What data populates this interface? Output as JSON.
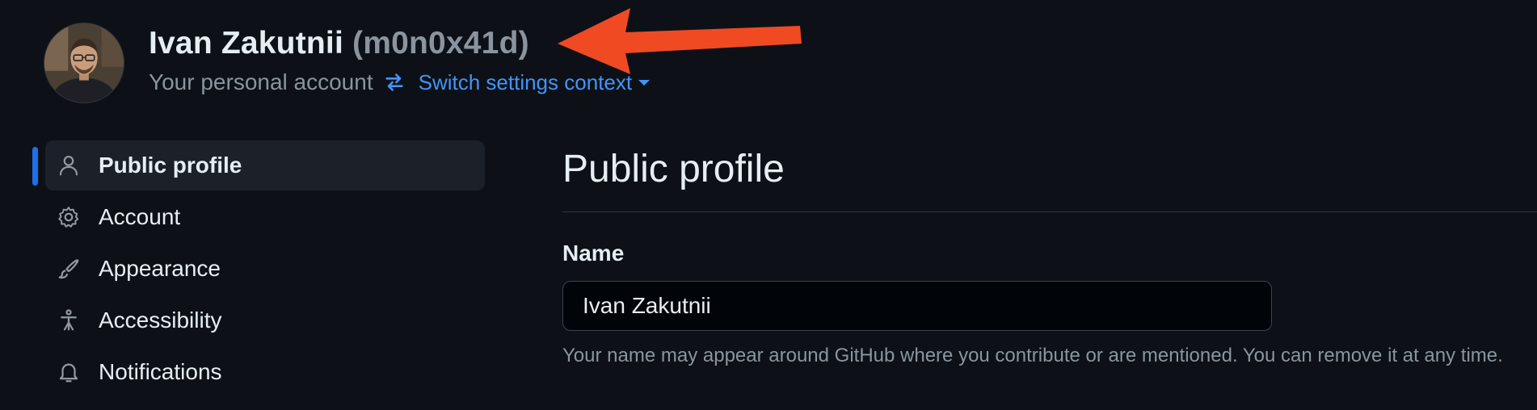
{
  "header": {
    "display_name": "Ivan Zakutnii",
    "login": "(m0n0x41d)",
    "account_type": "Your personal account",
    "switch_context_label": "Switch settings context"
  },
  "sidebar": {
    "items": [
      {
        "label": "Public profile",
        "icon": "person-icon",
        "active": true
      },
      {
        "label": "Account",
        "icon": "gear-icon",
        "active": false
      },
      {
        "label": "Appearance",
        "icon": "paintbrush-icon",
        "active": false
      },
      {
        "label": "Accessibility",
        "icon": "accessibility-icon",
        "active": false
      },
      {
        "label": "Notifications",
        "icon": "bell-icon",
        "active": false
      }
    ]
  },
  "main": {
    "title": "Public profile",
    "name_field": {
      "label": "Name",
      "value": "Ivan Zakutnii",
      "help": "Your name may appear around GitHub where you contribute or are mentioned. You can remove it at any time."
    }
  },
  "colors": {
    "background": "#0d1117",
    "accent": "#1f6feb",
    "link": "#4493f8",
    "annotation_arrow": "#f04a23"
  }
}
